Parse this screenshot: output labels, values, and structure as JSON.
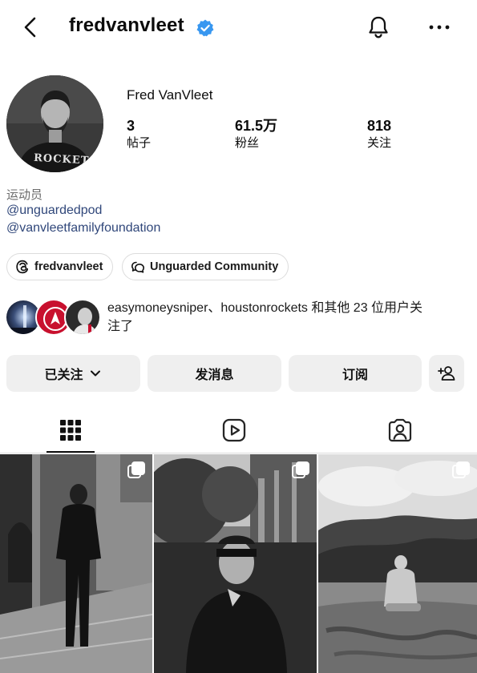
{
  "header": {
    "username": "fredvanvleet"
  },
  "profile": {
    "full_name": "Fred VanVleet",
    "stats": [
      {
        "value": "3",
        "label": "帖子"
      },
      {
        "value": "61.5万",
        "label": "粉丝"
      },
      {
        "value": "818",
        "label": "关注"
      }
    ],
    "category": "运动员",
    "links": [
      "@unguardedpod",
      "@vanvleetfamilyfoundation"
    ],
    "pills": [
      {
        "label": "fredvanvleet",
        "icon": "threads-icon"
      },
      {
        "label": "Unguarded Community",
        "icon": "community-chat-icon"
      }
    ],
    "followed_by_line1": "easymoneysniper、houstonrockets 和其他 23 位用户关",
    "followed_by_line2": "注了"
  },
  "actions": {
    "following_label": "已关注",
    "message_label": "发消息",
    "subscribe_label": "订阅"
  },
  "tabs": [
    {
      "icon": "grid-icon",
      "active": true
    },
    {
      "icon": "reels-icon",
      "active": false
    },
    {
      "icon": "tagged-icon",
      "active": false
    }
  ],
  "avatar_jersey_text": "ROCKETS",
  "colors": {
    "verified": "#3897f0",
    "link": "#30477a",
    "button_bg": "#efefef"
  }
}
